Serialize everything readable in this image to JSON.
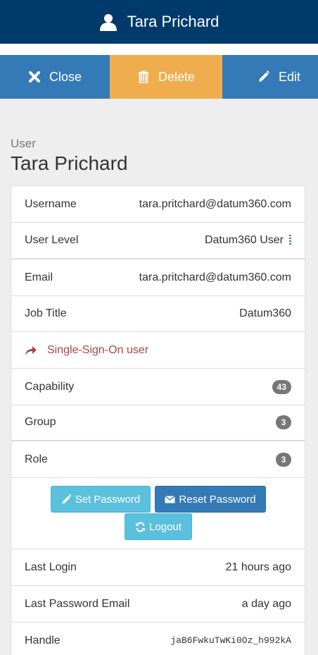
{
  "header": {
    "title": "Tara Prichard",
    "icon": "user-icon",
    "bg_color": "#003a6b"
  },
  "actions": {
    "close_label": "Close",
    "delete_label": "Delete",
    "edit_label": "Edit",
    "primary_color": "#337ab7",
    "warning_color": "#f0ad4e"
  },
  "section": {
    "label": "User",
    "name": "Tara Prichard"
  },
  "details": {
    "username_label": "Username",
    "username_value": "tara.pritchard@datum360.com",
    "user_level_label": "User Level",
    "user_level_value": "Datum360 User",
    "email_label": "Email",
    "email_value": "tara.pritchard@datum360.com",
    "job_title_label": "Job Title",
    "job_title_value": "Datum360",
    "sso_label": "Single-Sign-On user",
    "sso_color": "#a94442",
    "capability_label": "Capability",
    "capability_count": "43",
    "group_label": "Group",
    "group_count": "3",
    "role_label": "Role",
    "role_count": "3"
  },
  "buttons": {
    "set_password": "Set Password",
    "reset_password": "Reset Password",
    "logout": "Logout"
  },
  "meta": {
    "last_login_label": "Last Login",
    "last_login_value": "21 hours ago",
    "last_password_email_label": "Last Password Email",
    "last_password_email_value": "a day ago",
    "handle_label": "Handle",
    "handle_value": "jaB6FwkuTwKi0Oz_h992kA"
  }
}
